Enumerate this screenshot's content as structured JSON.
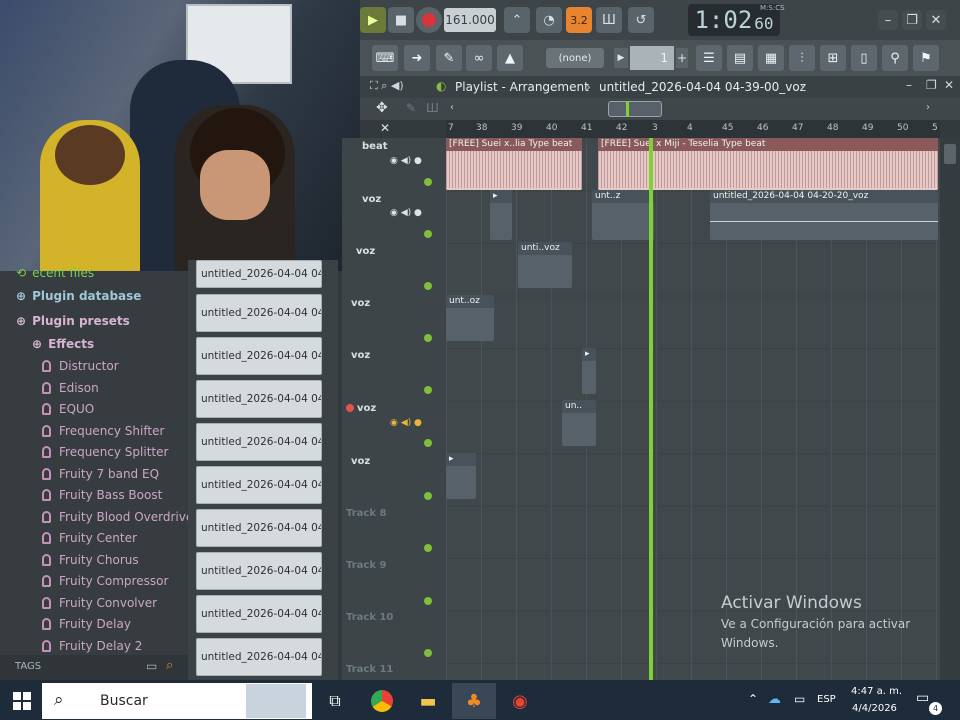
{
  "toolbar": {
    "tempo": "161.000",
    "pattern_number": "1",
    "time_display": "1:02",
    "time_small": "60",
    "time_mode": "M:S:CS",
    "snap_value": "(none)",
    "accent_color": "#e8842e",
    "record_color": "#d8343c"
  },
  "playlist": {
    "title": "Playlist - Arrangement",
    "project": "untitled_2026-04-04 04-39-00_voz",
    "ruler": [
      "7",
      "38",
      "39",
      "40",
      "41",
      "42",
      "3",
      "4",
      "45",
      "46",
      "47",
      "48",
      "49",
      "50",
      "5"
    ]
  },
  "browser": {
    "top": [
      {
        "label": "Plugin database"
      },
      {
        "label": "Plugin presets"
      }
    ],
    "partial": "ecent files",
    "effects_label": "Effects",
    "effects": [
      "Distructor",
      "Edison",
      "EQUO",
      "Frequency Shifter",
      "Frequency Splitter",
      "Fruity 7 band EQ",
      "Fruity Bass Boost",
      "Fruity Blood Overdrive",
      "Fruity Center",
      "Fruity Chorus",
      "Fruity Compressor",
      "Fruity Convolver",
      "Fruity Delay",
      "Fruity Delay 2"
    ],
    "tags_label": "TAGS",
    "files": [
      "untitled_2026-04-04 04-...",
      "untitled_2026-04-04 04-...",
      "untitled_2026-04-04 04-...",
      "untitled_2026-04-04 04-...",
      "untitled_2026-04-04 04-...",
      "untitled_2026-04-04 04-...",
      "untitled_2026-04-04 04-...",
      "untitled_2026-04-04 04-...",
      "untitled_2026-04-04 04-..."
    ],
    "top_partial_file": "untitled_2026-04-04 04-..."
  },
  "tracks": {
    "names": [
      "beat",
      "voz",
      "voz",
      "voz",
      "voz",
      "voz",
      "voz"
    ],
    "empty": [
      "Track 8",
      "Track 9",
      "Track 10",
      "Track 11"
    ]
  },
  "clips": {
    "beat1": "[FREE] Suei x..lia Type beat",
    "beat2": "[FREE] Suei x Miji - Teselia Type beat",
    "v1a": "unt..z",
    "v1b": "untitled_2026-04-04 04-20-20_voz",
    "v2": "unti..voz",
    "v3": "unt..oz",
    "v5": "un.."
  },
  "watermark": {
    "title": "Activar Windows",
    "line1": "Ve a Configuración para activar",
    "line2": "Windows."
  },
  "taskbar": {
    "search": "Buscar",
    "lang": "ESP",
    "time": "4:47 a. m.",
    "date": "4/4/2026",
    "notifications": "4"
  }
}
